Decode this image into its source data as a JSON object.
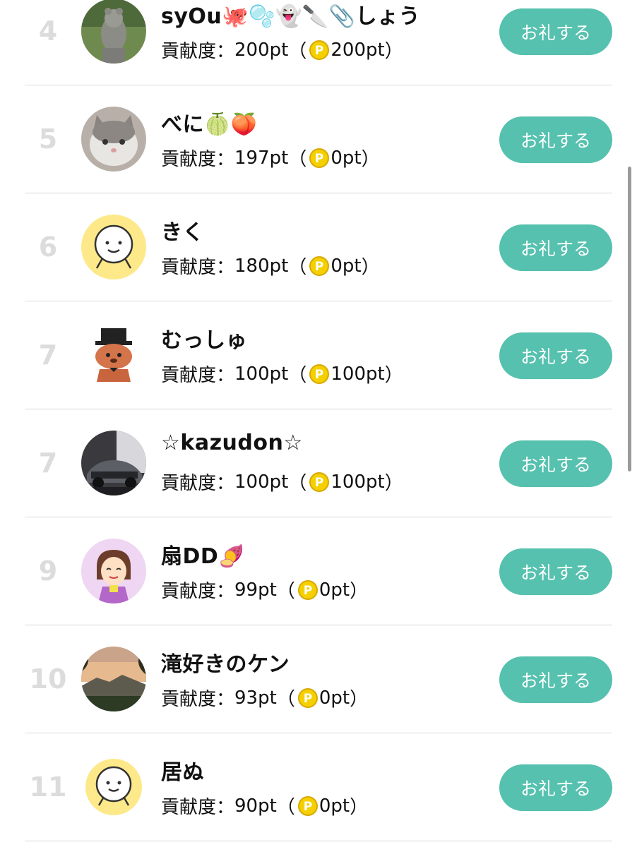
{
  "contribution_label": "貢献度：",
  "thanks_label": "お礼する",
  "accent": "#55c1ae",
  "rows": [
    {
      "rank": "4",
      "name": "syOu🐙🫧👻🔪📎しょう",
      "contrib": "200pt",
      "coin_pts": "200pt",
      "avatar": "squirrel-statue-photo"
    },
    {
      "rank": "5",
      "name": "べに🍈🍑",
      "contrib": "197pt",
      "coin_pts": "0pt",
      "avatar": "cat-photo"
    },
    {
      "rank": "6",
      "name": "きく",
      "contrib": "180pt",
      "coin_pts": "0pt",
      "avatar": "default-face-avatar"
    },
    {
      "rank": "7",
      "name": "むっしゅ",
      "contrib": "100pt",
      "coin_pts": "100pt",
      "avatar": "dog-top-hat-avatar"
    },
    {
      "rank": "7",
      "name": "☆kazudon☆",
      "contrib": "100pt",
      "coin_pts": "100pt",
      "avatar": "sports-car-photo"
    },
    {
      "rank": "9",
      "name": "扇DD🍠",
      "contrib": "99pt",
      "coin_pts": "0pt",
      "avatar": "drawn-girl-avatar"
    },
    {
      "rank": "10",
      "name": "滝好きのケン",
      "contrib": "93pt",
      "coin_pts": "0pt",
      "avatar": "landscape-photo"
    },
    {
      "rank": "11",
      "name": "居ぬ",
      "contrib": "90pt",
      "coin_pts": "0pt",
      "avatar": "default-face-avatar"
    }
  ]
}
